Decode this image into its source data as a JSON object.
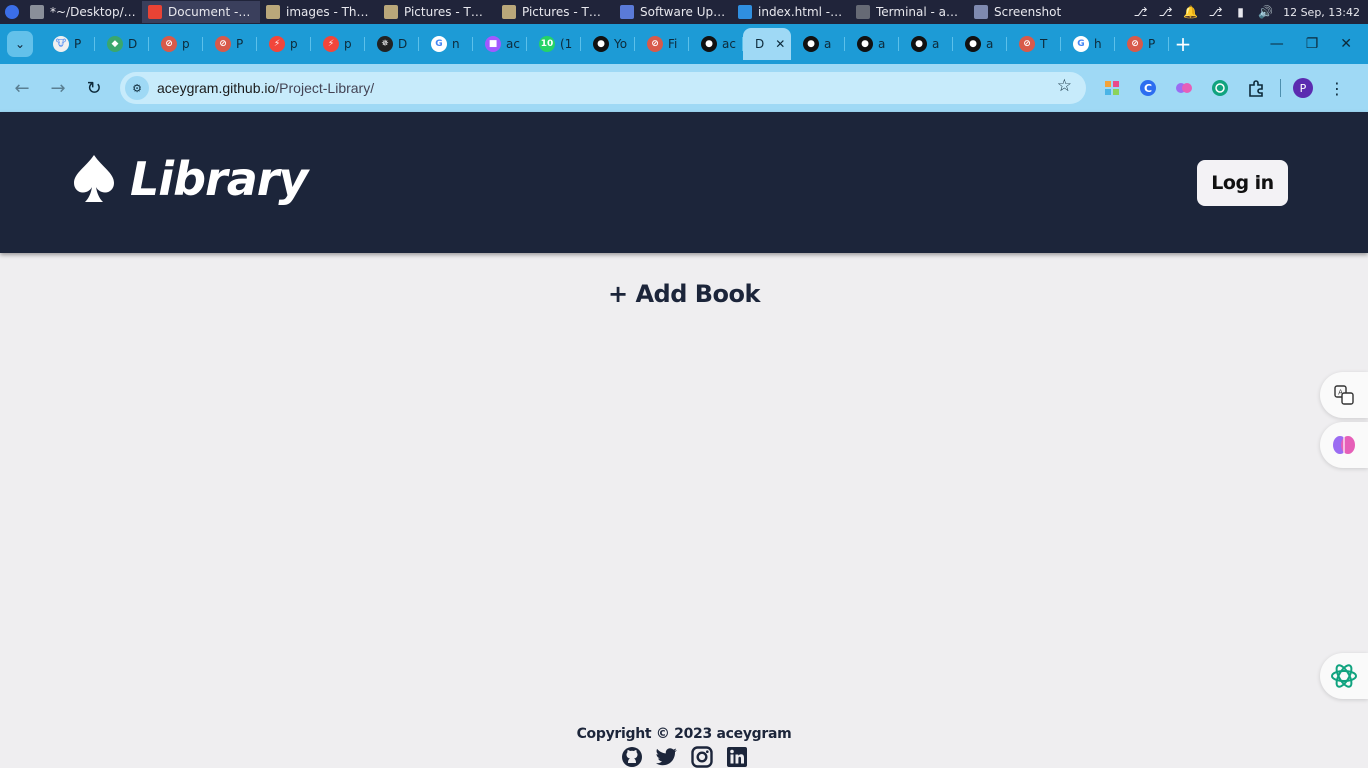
{
  "os_taskbar": {
    "tasks": [
      {
        "label": "*~/Desktop/G...",
        "icon": "text-editor-icon",
        "color": "#8a8f99"
      },
      {
        "label": "Document - G...",
        "icon": "chrome-icon",
        "color": "#e94335",
        "active": true
      },
      {
        "label": "images - Thun...",
        "icon": "folder-icon",
        "color": "#b9a77a"
      },
      {
        "label": "Pictures - Thu...",
        "icon": "folder-icon",
        "color": "#b9a77a"
      },
      {
        "label": "Pictures - Thu...",
        "icon": "folder-icon",
        "color": "#b9a77a"
      },
      {
        "label": "Software Upd...",
        "icon": "software-update-icon",
        "color": "#5a7ad8"
      },
      {
        "label": "index.html - Pr...",
        "icon": "vscode-icon",
        "color": "#2f8fe0"
      },
      {
        "label": "Terminal - ace...",
        "icon": "terminal-icon",
        "color": "#666a75"
      },
      {
        "label": "Screenshot",
        "icon": "screenshot-icon",
        "color": "#7f8ab0"
      }
    ],
    "clock": "12 Sep, 13:42"
  },
  "browser": {
    "tabs": [
      {
        "label": "P",
        "fav_color": "#f0f0f0",
        "fav_glyph": "🐮"
      },
      {
        "label": "D",
        "fav_color": "#3aa76d",
        "fav_glyph": "◆"
      },
      {
        "label": "p",
        "fav_color": "#d85a4a",
        "fav_glyph": "⊘"
      },
      {
        "label": "P",
        "fav_color": "#d85a4a",
        "fav_glyph": "⊘"
      },
      {
        "label": "p",
        "fav_color": "#f2463a",
        "fav_glyph": "⚡"
      },
      {
        "label": "p",
        "fav_color": "#f2463a",
        "fav_glyph": "⚡"
      },
      {
        "label": "D",
        "fav_color": "#222222",
        "fav_glyph": "✵"
      },
      {
        "label": "n",
        "fav_color": "#ffffff",
        "fav_glyph": "G"
      },
      {
        "label": "ac",
        "fav_color": "#a259ff",
        "fav_glyph": "■"
      },
      {
        "label": "(1",
        "fav_color": "#25d366",
        "fav_glyph": "10"
      },
      {
        "label": "Yo",
        "fav_color": "#111111",
        "fav_glyph": "●"
      },
      {
        "label": "Fi",
        "fav_color": "#d85a4a",
        "fav_glyph": "⊘"
      },
      {
        "label": "ac",
        "fav_color": "#111111",
        "fav_glyph": "●"
      },
      {
        "label": "D",
        "fav_color": "",
        "fav_glyph": "",
        "active": true
      },
      {
        "label": "a",
        "fav_color": "#111111",
        "fav_glyph": "●"
      },
      {
        "label": "a",
        "fav_color": "#111111",
        "fav_glyph": "●"
      },
      {
        "label": "a",
        "fav_color": "#111111",
        "fav_glyph": "●"
      },
      {
        "label": "a",
        "fav_color": "#111111",
        "fav_glyph": "●"
      },
      {
        "label": "T",
        "fav_color": "#d85a4a",
        "fav_glyph": "⊘"
      },
      {
        "label": "h",
        "fav_color": "#ffffff",
        "fav_glyph": "G"
      },
      {
        "label": "P",
        "fav_color": "#d85a4a",
        "fav_glyph": "⊘"
      }
    ],
    "url_host": "aceygram.github.io",
    "url_path": "/Project-Library/",
    "profile_initial": "P"
  },
  "page": {
    "brand_title": "Library",
    "login_label": "Log in",
    "add_book_label": "+ Add Book",
    "copyright": "Copyright © 2023 aceygram",
    "colors": {
      "header_bg": "#1c253a",
      "page_bg": "#efeef0",
      "accent_text": "#1c253a"
    }
  }
}
